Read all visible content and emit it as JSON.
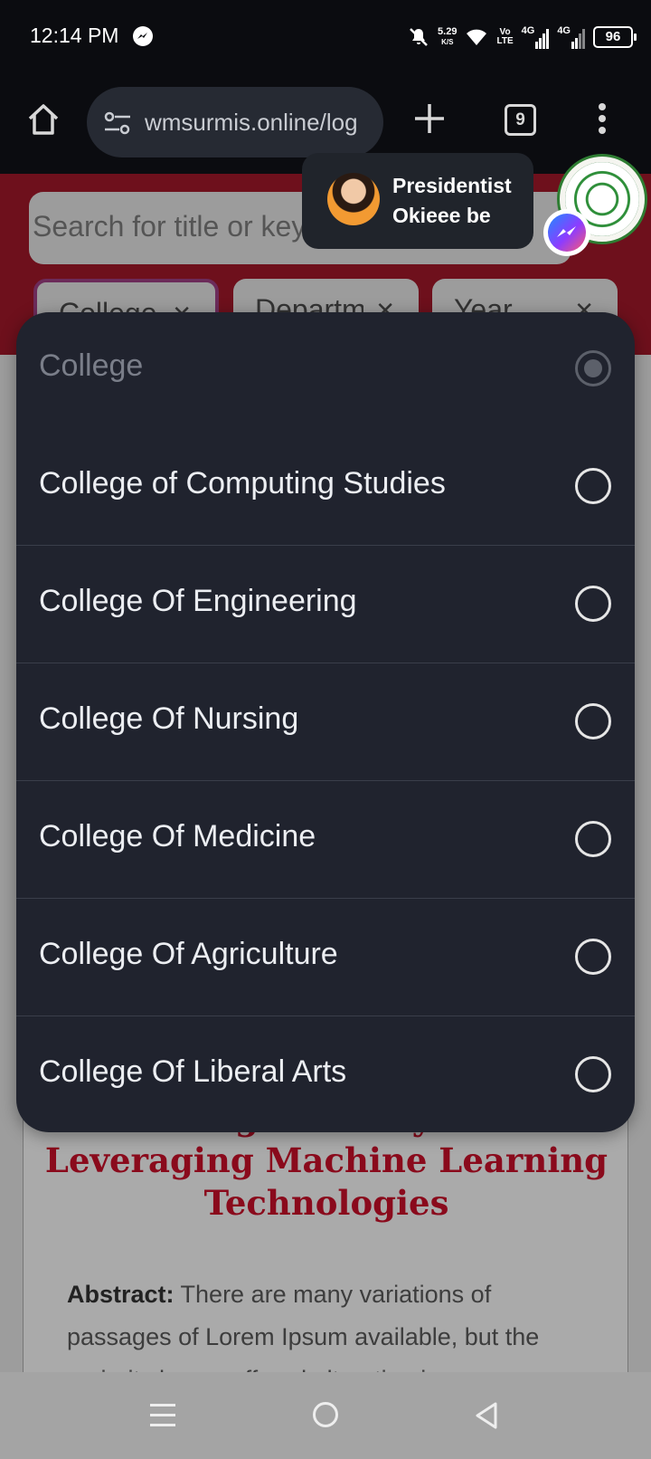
{
  "status_bar": {
    "time": "12:14 PM",
    "net_speed_value": "5.29",
    "net_speed_unit": "K/S",
    "volte": "Vo\nLTE",
    "signal_label_1": "4G",
    "signal_label_2": "4G",
    "battery": "96"
  },
  "browser": {
    "url": "wmsurmis.online/log",
    "tab_count": "9"
  },
  "page": {
    "search_placeholder": "Search for title or keyword",
    "filters": [
      "College",
      "Department",
      "Year"
    ],
    "filter_arrow": "⌄",
    "card_title": "Management System Leveraging Machine Learning Technologies",
    "abstract_label": "Abstract:",
    "abstract_text": " There are many variations of passages of Lorem Ipsum available, but the majority have suffered alteration in"
  },
  "dropdown": {
    "header": "College",
    "options": [
      "College of Computing Studies",
      "College Of Engineering",
      "College Of Nursing",
      "College Of Medicine",
      "College Of Agriculture",
      "College Of Liberal Arts"
    ]
  },
  "chat_head": {
    "line1": "Presidentist",
    "line2": "Okieee be"
  },
  "icons": {
    "home": "home-icon",
    "site_settings": "tune-icon",
    "new_tab": "plus-icon",
    "more": "more-vert-icon",
    "messenger": "messenger-icon",
    "nav_menu": "recent-apps-icon",
    "nav_home": "home-circle-icon",
    "nav_back": "back-triangle-icon"
  },
  "colors": {
    "hero_bg": "#6e101c",
    "title_red": "#8a0a1c",
    "dropdown_bg": "#20232e"
  }
}
